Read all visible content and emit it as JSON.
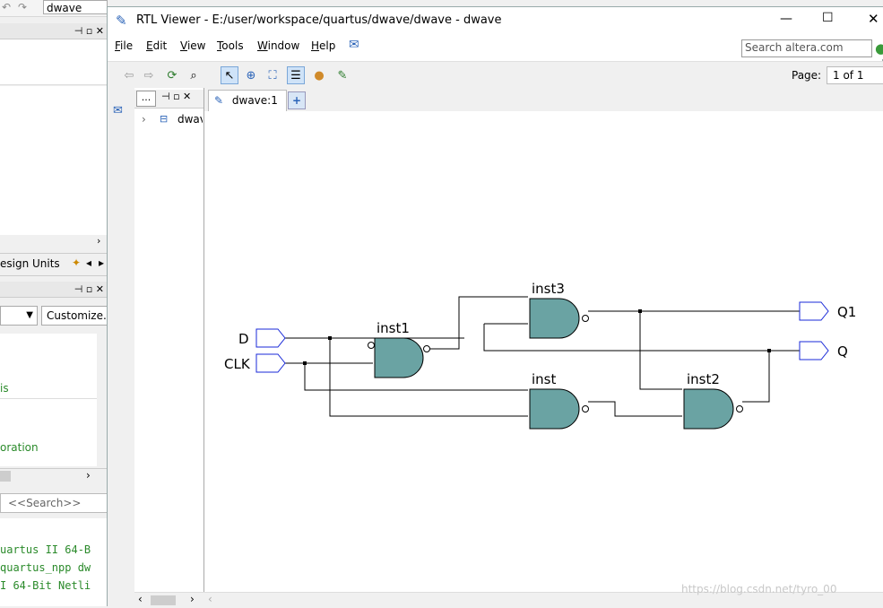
{
  "background_window": {
    "tab_field": "dwave",
    "panel_tab": "esign Units",
    "customize_button": "Customize...",
    "list_items": [
      "is",
      "oration"
    ],
    "search_placeholder": "<<Search>>",
    "console_lines": [
      "uartus II 64-B",
      "quartus_npp dw",
      "I 64-Bit Netli"
    ]
  },
  "window": {
    "title": "RTL Viewer - E:/user/workspace/quartus/dwave/dwave - dwave",
    "controls": [
      "—",
      "☐",
      "✕"
    ]
  },
  "menu": [
    {
      "label": "File",
      "mnemonic": "F"
    },
    {
      "label": "Edit",
      "mnemonic": "E"
    },
    {
      "label": "View",
      "mnemonic": "V"
    },
    {
      "label": "Tools",
      "mnemonic": "T"
    },
    {
      "label": "Window",
      "mnemonic": "W"
    },
    {
      "label": "Help",
      "mnemonic": "H"
    }
  ],
  "search": {
    "placeholder": "Search altera.com"
  },
  "toolbar": {
    "page_label": "Page:",
    "page_value": "1 of 1"
  },
  "hierarchy": {
    "header": "...",
    "item": "dwav"
  },
  "tab": {
    "label": "dwave:1"
  },
  "schematic": {
    "inputs": [
      "D",
      "CLK"
    ],
    "outputs": [
      "Q1",
      "Q"
    ],
    "gates": [
      "inst1",
      "inst3",
      "inst",
      "inst2"
    ],
    "gate_color": "#6aa3a3"
  },
  "watermark": "https://blog.csdn.net/tyro_00"
}
